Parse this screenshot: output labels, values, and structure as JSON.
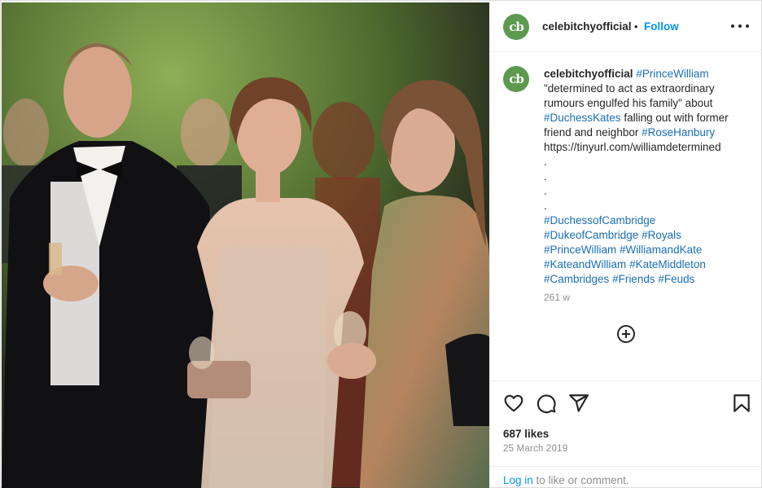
{
  "post": {
    "image_alt": "Photo of three guests at an outdoor evening event",
    "header": {
      "avatar_text": "cb",
      "username": "celebitchyofficial",
      "separator": "•",
      "follow_label": "Follow",
      "more_icon": "more-horizontal-icon"
    },
    "caption": {
      "avatar_text": "cb",
      "username": "celebitchyofficial",
      "lines": [
        {
          "parts": [
            {
              "text": "#PrinceWilliam",
              "tag": true
            }
          ]
        },
        {
          "parts": [
            {
              "text": "\"determined to act as extraordinary",
              "tag": false
            }
          ]
        },
        {
          "parts": [
            {
              "text": "rumours engulfed his family\" about",
              "tag": false
            }
          ]
        },
        {
          "parts": [
            {
              "text": "#DuchessKates",
              "tag": true
            },
            {
              "text": " falling out with former",
              "tag": false
            }
          ]
        },
        {
          "parts": [
            {
              "text": "friend and neighbor ",
              "tag": false
            },
            {
              "text": "#RoseHanbury",
              "tag": true
            }
          ]
        },
        {
          "parts": [
            {
              "text": "https://tinyurl.com/williamdetermined",
              "tag": false
            }
          ]
        },
        {
          "parts": [
            {
              "text": ".",
              "tag": false
            }
          ]
        },
        {
          "parts": [
            {
              "text": ".",
              "tag": false
            }
          ]
        },
        {
          "parts": [
            {
              "text": ".",
              "tag": false
            }
          ]
        },
        {
          "parts": [
            {
              "text": ".",
              "tag": false
            }
          ]
        },
        {
          "parts": [
            {
              "text": "#DuchessofCambridge",
              "tag": true
            }
          ]
        },
        {
          "parts": [
            {
              "text": "#DukeofCambridge",
              "tag": true
            },
            {
              "text": " ",
              "tag": false
            },
            {
              "text": "#Royals",
              "tag": true
            }
          ]
        },
        {
          "parts": [
            {
              "text": "#PrinceWilliam",
              "tag": true
            },
            {
              "text": " ",
              "tag": false
            },
            {
              "text": "#WilliamandKate",
              "tag": true
            }
          ]
        },
        {
          "parts": [
            {
              "text": "#KateandWilliam",
              "tag": true
            },
            {
              "text": " ",
              "tag": false
            },
            {
              "text": "#KateMiddleton",
              "tag": true
            }
          ]
        },
        {
          "parts": [
            {
              "text": "#Cambridges",
              "tag": true
            },
            {
              "text": " ",
              "tag": false
            },
            {
              "text": "#Friends",
              "tag": true
            },
            {
              "text": " ",
              "tag": false
            },
            {
              "text": "#Feuds",
              "tag": true
            }
          ]
        }
      ],
      "time": "261 w",
      "load_more_icon": "plus-circle-icon"
    },
    "actions": {
      "like_icon": "heart-icon",
      "comment_icon": "comment-icon",
      "share_icon": "send-icon",
      "save_icon": "bookmark-icon",
      "likes": "687 likes",
      "date": "25 March 2019",
      "login_link": "Log in",
      "login_suffix": " to like or comment."
    },
    "colors": {
      "link_blue": "#0095f6",
      "hashtag_blue": "#1a6fb5",
      "avatar_green": "#5d9a4f",
      "muted_gray": "#8e8e8e"
    }
  }
}
